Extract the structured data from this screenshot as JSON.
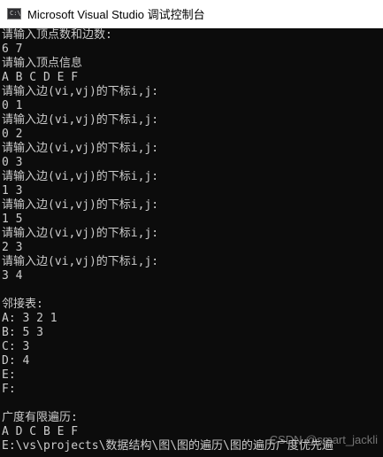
{
  "window": {
    "icon_label": "C:\\",
    "title": "Microsoft Visual Studio 调试控制台"
  },
  "console": {
    "lines": [
      "请输入顶点数和边数:",
      "6 7",
      "请输入顶点信息",
      "A B C D E F",
      "请输入边(vi,vj)的下标i,j:",
      "0 1",
      "请输入边(vi,vj)的下标i,j:",
      "0 2",
      "请输入边(vi,vj)的下标i,j:",
      "0 3",
      "请输入边(vi,vj)的下标i,j:",
      "1 3",
      "请输入边(vi,vj)的下标i,j:",
      "1 5",
      "请输入边(vi,vj)的下标i,j:",
      "2 3",
      "请输入边(vi,vj)的下标i,j:",
      "3 4",
      "",
      "邻接表:",
      "A: 3 2 1",
      "B: 5 3",
      "C: 3",
      "D: 4",
      "E:",
      "F:",
      "",
      "广度有限遍历:",
      "A D C B E F",
      "E:\\vs\\projects\\数据结构\\图\\图的遍历\\图的遍历广度优先遍"
    ]
  },
  "watermark": "CSDN @smart_jackli"
}
